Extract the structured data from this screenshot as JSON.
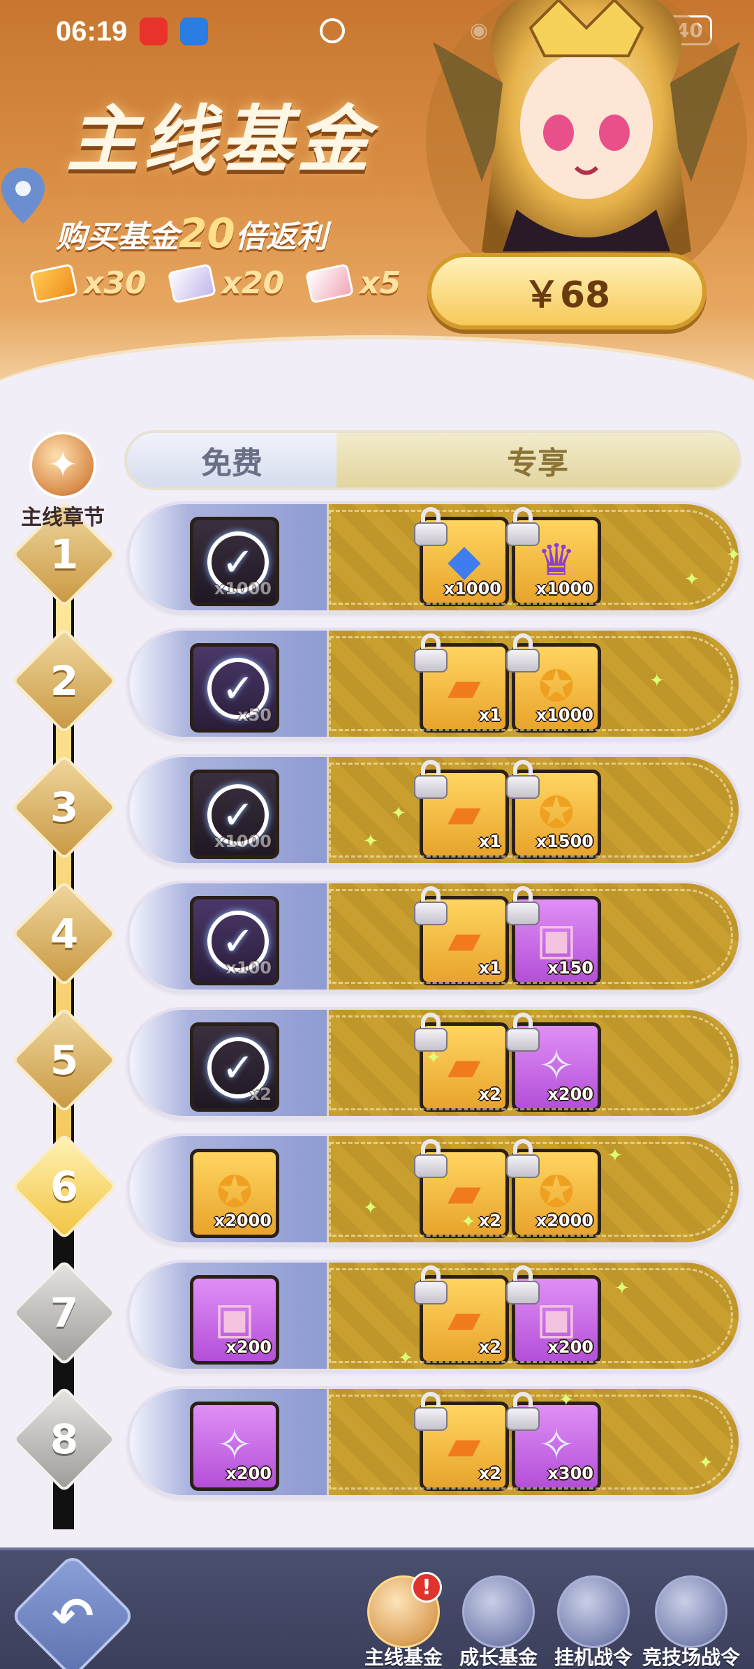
{
  "status_bar": {
    "time": "06:19",
    "battery": "40"
  },
  "banner": {
    "title": "主线基金",
    "subtitle_prefix": "购买基金",
    "subtitle_multiplier": "20",
    "subtitle_suffix": "倍返利",
    "tickets": [
      {
        "icon": "gold-ticket-icon",
        "count": "x30"
      },
      {
        "icon": "silver-ticket-icon",
        "count": "x20"
      },
      {
        "icon": "pink-ticket-icon",
        "count": "x5"
      }
    ],
    "price": "￥68"
  },
  "chapter": {
    "label": "主线章节"
  },
  "tabs": {
    "free": "免费",
    "vip": "专享"
  },
  "rows": [
    {
      "level": "1",
      "state": "done",
      "free": {
        "icon": "check-icon",
        "count": "x1000"
      },
      "vip": [
        {
          "icon": "blue-gem-icon",
          "count": "x1000"
        },
        {
          "icon": "vip-badge-icon",
          "count": "x1000"
        }
      ]
    },
    {
      "level": "2",
      "state": "done",
      "free": {
        "icon": "check-icon",
        "count": "x50"
      },
      "vip": [
        {
          "icon": "gold-ticket-icon",
          "count": "x1"
        },
        {
          "icon": "gold-coin-icon",
          "count": "x1000"
        }
      ]
    },
    {
      "level": "3",
      "state": "done",
      "free": {
        "icon": "check-icon",
        "count": "x1000"
      },
      "vip": [
        {
          "icon": "gold-ticket-icon",
          "count": "x1"
        },
        {
          "icon": "gold-coin-icon",
          "count": "x1500"
        }
      ]
    },
    {
      "level": "4",
      "state": "done",
      "free": {
        "icon": "check-icon",
        "count": "x100"
      },
      "vip": [
        {
          "icon": "gold-ticket-icon",
          "count": "x1"
        },
        {
          "icon": "pink-book-icon",
          "count": "x150"
        }
      ]
    },
    {
      "level": "5",
      "state": "done",
      "free": {
        "icon": "check-icon",
        "count": "x2"
      },
      "vip": [
        {
          "icon": "gold-ticket-icon",
          "count": "x2"
        },
        {
          "icon": "crystal-shard-icon",
          "count": "x200"
        }
      ]
    },
    {
      "level": "6",
      "state": "active",
      "free": {
        "icon": "gold-coin-icon",
        "count": "x2000"
      },
      "vip": [
        {
          "icon": "gold-ticket-icon",
          "count": "x2"
        },
        {
          "icon": "gold-coin-icon",
          "count": "x2000"
        }
      ]
    },
    {
      "level": "7",
      "state": "locked",
      "free": {
        "icon": "pink-book-icon",
        "count": "x200"
      },
      "vip": [
        {
          "icon": "gold-ticket-icon",
          "count": "x2"
        },
        {
          "icon": "pink-book-icon",
          "count": "x200"
        }
      ]
    },
    {
      "level": "8",
      "state": "locked",
      "free": {
        "icon": "crystal-shard-icon",
        "count": "x200"
      },
      "vip": [
        {
          "icon": "gold-ticket-icon",
          "count": "x2"
        },
        {
          "icon": "crystal-shard-icon",
          "count": "x300"
        }
      ]
    }
  ],
  "progress": {
    "completed_levels": 5,
    "current_level": 6
  },
  "bottom_nav": {
    "back_icon": "back-arrow-icon",
    "items": [
      {
        "label": "主线基金",
        "icon": "main-fund-icon",
        "active": true,
        "badge": "!"
      },
      {
        "label": "成长基金",
        "icon": "growth-fund-icon",
        "active": false
      },
      {
        "label": "挂机战令",
        "icon": "idle-pass-icon",
        "active": false
      },
      {
        "label": "竞技场战令",
        "icon": "arena-pass-icon",
        "active": false
      }
    ]
  }
}
